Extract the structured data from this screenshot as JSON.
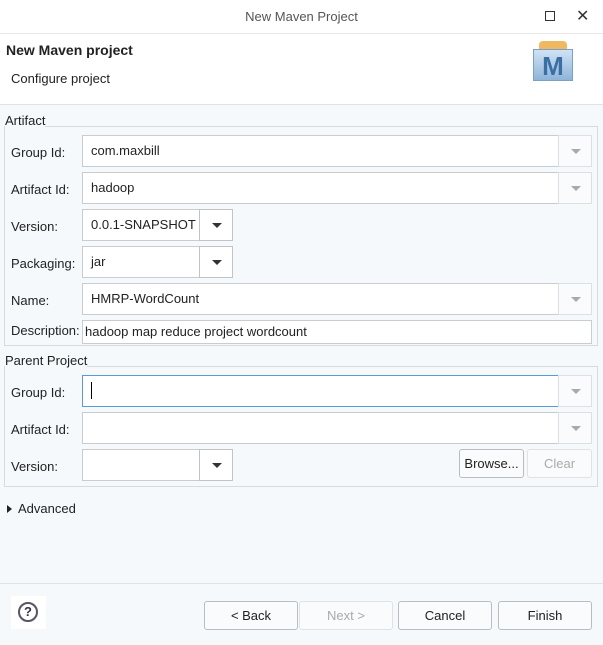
{
  "window": {
    "title": "New Maven Project"
  },
  "header": {
    "title": "New Maven project",
    "subtitle": "Configure project",
    "logo_letter": "M"
  },
  "artifact": {
    "label": "Artifact",
    "group_id": {
      "label": "Group Id:",
      "value": "com.maxbill"
    },
    "artifact_id": {
      "label": "Artifact Id:",
      "value": "hadoop"
    },
    "version": {
      "label": "Version:",
      "value": "0.0.1-SNAPSHOT"
    },
    "packaging": {
      "label": "Packaging:",
      "value": "jar"
    },
    "name": {
      "label": "Name:",
      "value": "HMRP-WordCount"
    },
    "description": {
      "label": "Description:",
      "value": "hadoop map reduce project wordcount"
    }
  },
  "parent": {
    "label": "Parent Project",
    "group_id": {
      "label": "Group Id:",
      "value": ""
    },
    "artifact_id": {
      "label": "Artifact Id:",
      "value": ""
    },
    "version": {
      "label": "Version:",
      "value": ""
    },
    "browse": "Browse...",
    "clear": "Clear"
  },
  "advanced": "Advanced",
  "footer": {
    "back": "< Back",
    "next": "Next >",
    "cancel": "Cancel",
    "finish": "Finish",
    "help": "?"
  }
}
